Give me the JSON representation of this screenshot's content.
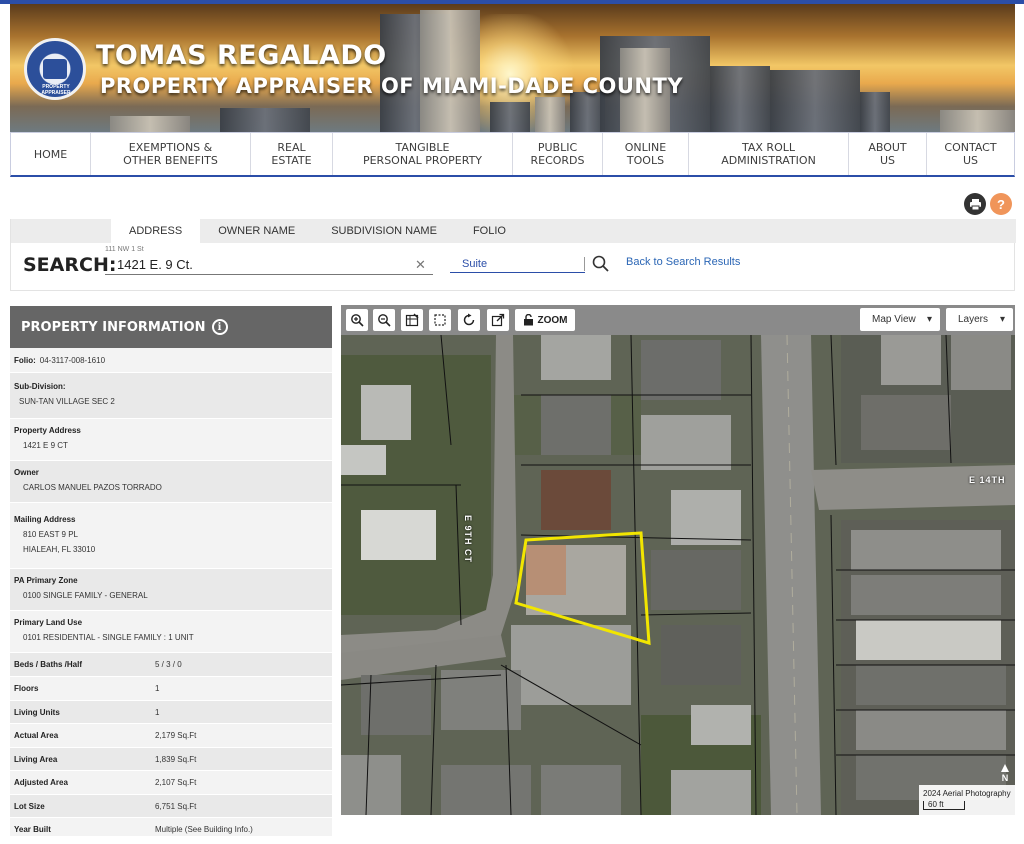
{
  "header": {
    "brand_name": "TOMAS REGALADO",
    "brand_subtitle": "PROPERTY APPRAISER OF MIAMI-DADE COUNTY",
    "seal_text": "PROPERTY APPRAISER"
  },
  "nav": [
    {
      "id": "home",
      "label": "HOME"
    },
    {
      "id": "exemptions",
      "label": "EXEMPTIONS &\nOTHER BENEFITS"
    },
    {
      "id": "real-estate",
      "label": "REAL\nESTATE"
    },
    {
      "id": "tangible",
      "label": "TANGIBLE\nPERSONAL PROPERTY"
    },
    {
      "id": "public-records",
      "label": "PUBLIC\nRECORDS"
    },
    {
      "id": "online-tools",
      "label": "ONLINE\nTOOLS"
    },
    {
      "id": "tax-roll",
      "label": "TAX ROLL\nADMINISTRATION"
    },
    {
      "id": "about",
      "label": "ABOUT\nUS"
    },
    {
      "id": "contact",
      "label": "CONTACT\nUS"
    }
  ],
  "utility": {
    "print_icon": "print-icon",
    "help_glyph": "?"
  },
  "search": {
    "tabs": [
      "ADDRESS",
      "OWNER NAME",
      "SUBDIVISION NAME",
      "FOLIO"
    ],
    "active_tab": "ADDRESS",
    "label": "SEARCH:",
    "hint": "111 NW 1 St",
    "value": "1421 E. 9 Ct.",
    "clear_glyph": "✕",
    "suite_placeholder": "Suite",
    "back_link": "Back to Search Results"
  },
  "property": {
    "header": "PROPERTY INFORMATION",
    "info_glyph": "i",
    "folio_label": "Folio:",
    "folio": "04-3117-008-1610",
    "subdivision_label": "Sub-Division:",
    "subdivision": "SUN-TAN VILLAGE SEC 2",
    "address_label": "Property Address",
    "address": "1421 E 9 CT",
    "owner_label": "Owner",
    "owner": "CARLOS MANUEL PAZOS TORRADO",
    "mailing_label": "Mailing Address",
    "mailing_line1": "810 EAST 9 PL",
    "mailing_line2": "HIALEAH, FL 33010",
    "zone_label": "PA Primary Zone",
    "zone": "0100 SINGLE FAMILY - GENERAL",
    "land_use_label": "Primary Land Use",
    "land_use": "0101 RESIDENTIAL - SINGLE FAMILY : 1 UNIT",
    "stats": [
      {
        "label": "Beds / Baths /Half",
        "value": "5 / 3 / 0"
      },
      {
        "label": "Floors",
        "value": "1"
      },
      {
        "label": "Living Units",
        "value": "1"
      },
      {
        "label": "Actual Area",
        "value": "2,179 Sq.Ft"
      },
      {
        "label": "Living Area",
        "value": "1,839 Sq.Ft"
      },
      {
        "label": "Adjusted Area",
        "value": "2,107 Sq.Ft"
      },
      {
        "label": "Lot Size",
        "value": "6,751 Sq.Ft"
      },
      {
        "label": "Year Built",
        "value": "Multiple (See Building Info.)"
      }
    ]
  },
  "map": {
    "zoom_label": "ZOOM",
    "view_dropdown": "Map View",
    "layers_dropdown": "Layers",
    "street_1": "E 9TH CT",
    "street_2": "E 14TH",
    "scale_caption": "2024 Aerial Photography",
    "scale_value": "60 ft",
    "north_label": "N",
    "parcel_outline_color": "#f2e600"
  }
}
